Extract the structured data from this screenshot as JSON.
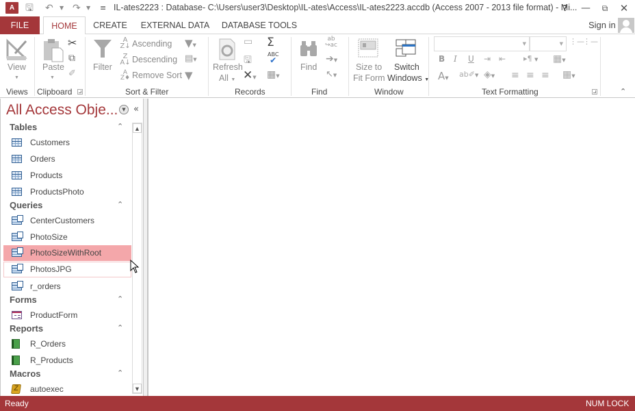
{
  "titlebar": {
    "app_icon": "A",
    "title": "IL-ates2223 : Database- C:\\Users\\user3\\Desktop\\IL-ates\\Access\\IL-ates2223.accdb (Access 2007 - 2013 file format) - Mi...",
    "help": "?",
    "minimize": "—",
    "restore": "⧉",
    "close": "✕"
  },
  "tabs": [
    {
      "label": "FILE"
    },
    {
      "label": "HOME",
      "active": true
    },
    {
      "label": "CREATE"
    },
    {
      "label": "EXTERNAL DATA"
    },
    {
      "label": "DATABASE TOOLS"
    }
  ],
  "account": {
    "signin": "Sign in"
  },
  "ribbon": {
    "groups": {
      "views": "Views",
      "clipboard": "Clipboard",
      "sort_filter": "Sort & Filter",
      "records": "Records",
      "find": "Find",
      "window": "Window",
      "text_formatting": "Text Formatting"
    },
    "view": "View",
    "paste": "Paste",
    "filter": "Filter",
    "ascending": "Ascending",
    "descending": "Descending",
    "remove_sort": "Remove Sort",
    "refresh": "Refresh",
    "refresh_all": "All",
    "find": "Find",
    "size_to_fit_1": "Size to",
    "size_to_fit_2": "Fit Form",
    "switch_windows_1": "Switch",
    "switch_windows_2": "Windows",
    "bold": "B",
    "italic": "I",
    "underline": "U",
    "font_color": "A"
  },
  "nav": {
    "title": "All Access Obje...",
    "sections": [
      {
        "label": "Tables",
        "items": [
          {
            "name": "Customers",
            "type": "table"
          },
          {
            "name": "Orders",
            "type": "table"
          },
          {
            "name": "Products",
            "type": "table"
          },
          {
            "name": "ProductsPhoto",
            "type": "table"
          }
        ]
      },
      {
        "label": "Queries",
        "items": [
          {
            "name": "CenterCustomers",
            "type": "query"
          },
          {
            "name": "PhotoSize",
            "type": "query"
          },
          {
            "name": "PhotoSizeWithRoot",
            "type": "query",
            "selected": true
          },
          {
            "name": "PhotosJPG",
            "type": "query",
            "hover": true
          },
          {
            "name": "r_orders",
            "type": "query"
          }
        ]
      },
      {
        "label": "Forms",
        "items": [
          {
            "name": "ProductForm",
            "type": "form"
          }
        ]
      },
      {
        "label": "Reports",
        "items": [
          {
            "name": "R_Orders",
            "type": "report"
          },
          {
            "name": "R_Products",
            "type": "report"
          }
        ]
      },
      {
        "label": "Macros",
        "items": [
          {
            "name": "autoexec",
            "type": "macro"
          }
        ]
      }
    ]
  },
  "status": {
    "left": "Ready",
    "right": "NUM LOCK"
  },
  "colors": {
    "accent": "#a4373a",
    "selected_item": "#f4a7aa"
  }
}
